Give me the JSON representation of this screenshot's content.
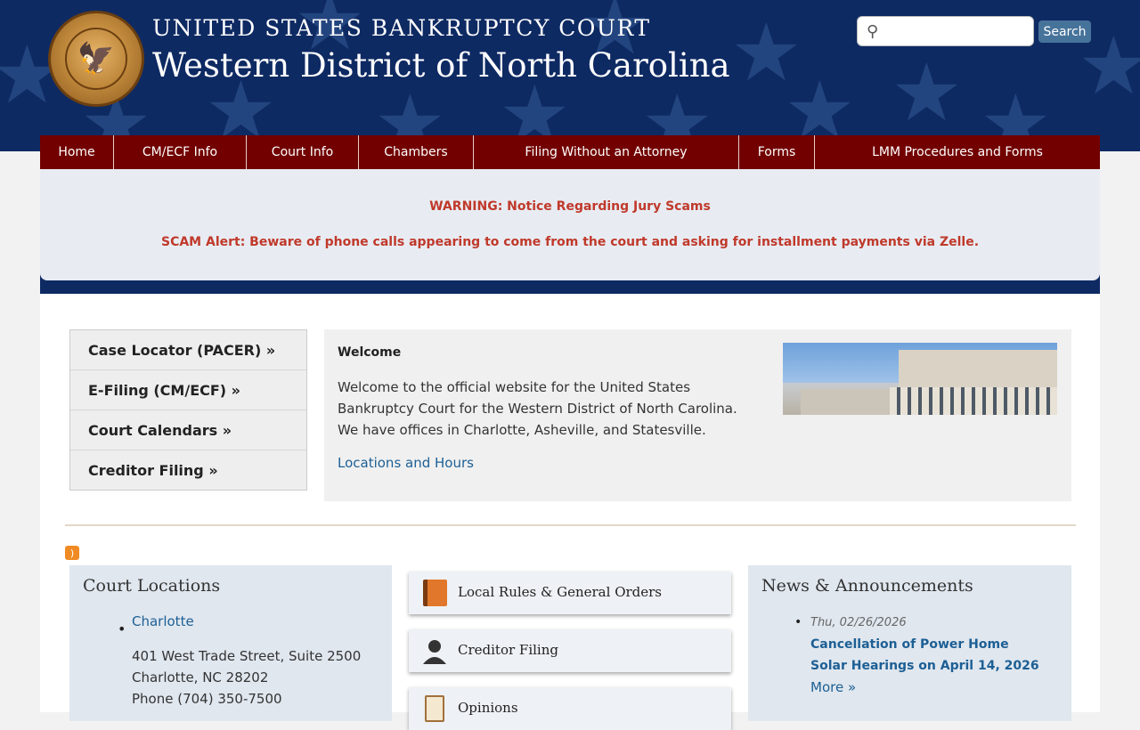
{
  "header": {
    "court_name_top": "UNITED STATES BANKRUPTCY COURT",
    "court_name_main": "Western District of North Carolina",
    "seal_icon": "court-seal",
    "search": {
      "placeholder": "",
      "button_label": "Search",
      "icon": "search-icon"
    }
  },
  "nav": {
    "items": [
      {
        "label": "Home"
      },
      {
        "label": "CM/ECF Info"
      },
      {
        "label": "Court Info"
      },
      {
        "label": "Chambers"
      },
      {
        "label": "Filing Without an Attorney"
      },
      {
        "label": "Forms"
      },
      {
        "label": "LMM Procedures and Forms"
      }
    ]
  },
  "alerts": {
    "line1": "WARNING:  Notice Regarding Jury Scams",
    "line2": "SCAM Alert: Beware of phone calls appearing to come from the court and asking for installment payments via Zelle.",
    "color": "#c0392b"
  },
  "quicklinks": {
    "items": [
      {
        "label": "Case Locator (PACER) »"
      },
      {
        "label": "E-Filing (CM/ECF) »"
      },
      {
        "label": "Court Calendars »"
      },
      {
        "label": "Creditor Filing »"
      }
    ]
  },
  "welcome": {
    "title": "Welcome",
    "text": "Welcome to the official website for the United States Bankruptcy Court for the Western District of North Carolina. We have offices in Charlotte, Asheville, and Statesville.",
    "link": "Locations and Hours"
  },
  "court_locations": {
    "title": "Court Locations",
    "location_name": "Charlotte",
    "address_line1": "401 West Trade Street, Suite 2500",
    "address_line2": "Charlotte, NC 28202",
    "phone": "Phone (704) 350-7500"
  },
  "tiles": [
    {
      "label": "Local Rules & General Orders",
      "icon": "book-icon"
    },
    {
      "label": "Creditor Filing",
      "icon": "person-icon"
    },
    {
      "label": "Opinions",
      "icon": "clipboard-icon"
    }
  ],
  "news": {
    "title": "News & Announcements",
    "items": [
      {
        "date": "Thu, 02/26/2026",
        "headline": "Cancellation of Power Home Solar Hearings on April 14, 2026",
        "more": "More »"
      }
    ]
  },
  "colors": {
    "header_bg": "#0e2a63",
    "nav_bg": "#720000",
    "link": "#1d5f94",
    "search_button": "#46739a"
  }
}
